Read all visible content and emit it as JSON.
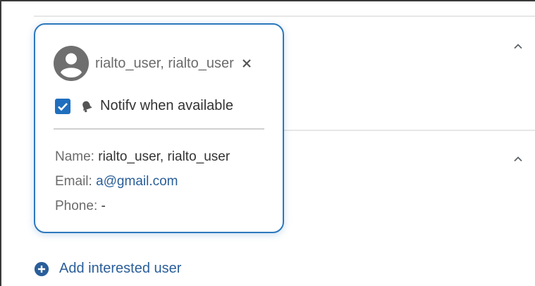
{
  "card": {
    "title": "rialto_user, rialto_user",
    "notify_label": "Notifv when available",
    "notify_checked": true,
    "name_label": "Name:",
    "name_value": "rialto_user, rialto_user",
    "email_label": "Email:",
    "email_value": "a@gmail.com",
    "phone_label": "Phone:",
    "phone_value": "-"
  },
  "add_user": {
    "label": "Add interested user"
  },
  "icons": {
    "avatar": "account-circle-icon",
    "close": "close-icon",
    "checkbox": "checkbox-checked-icon",
    "bell": "bell-icon",
    "chevron": "chevron-up-icon",
    "add": "plus-circle-icon"
  },
  "colors": {
    "accent": "#2c78bd",
    "link": "#2a5e99",
    "checkbox": "#1f6fbe"
  }
}
